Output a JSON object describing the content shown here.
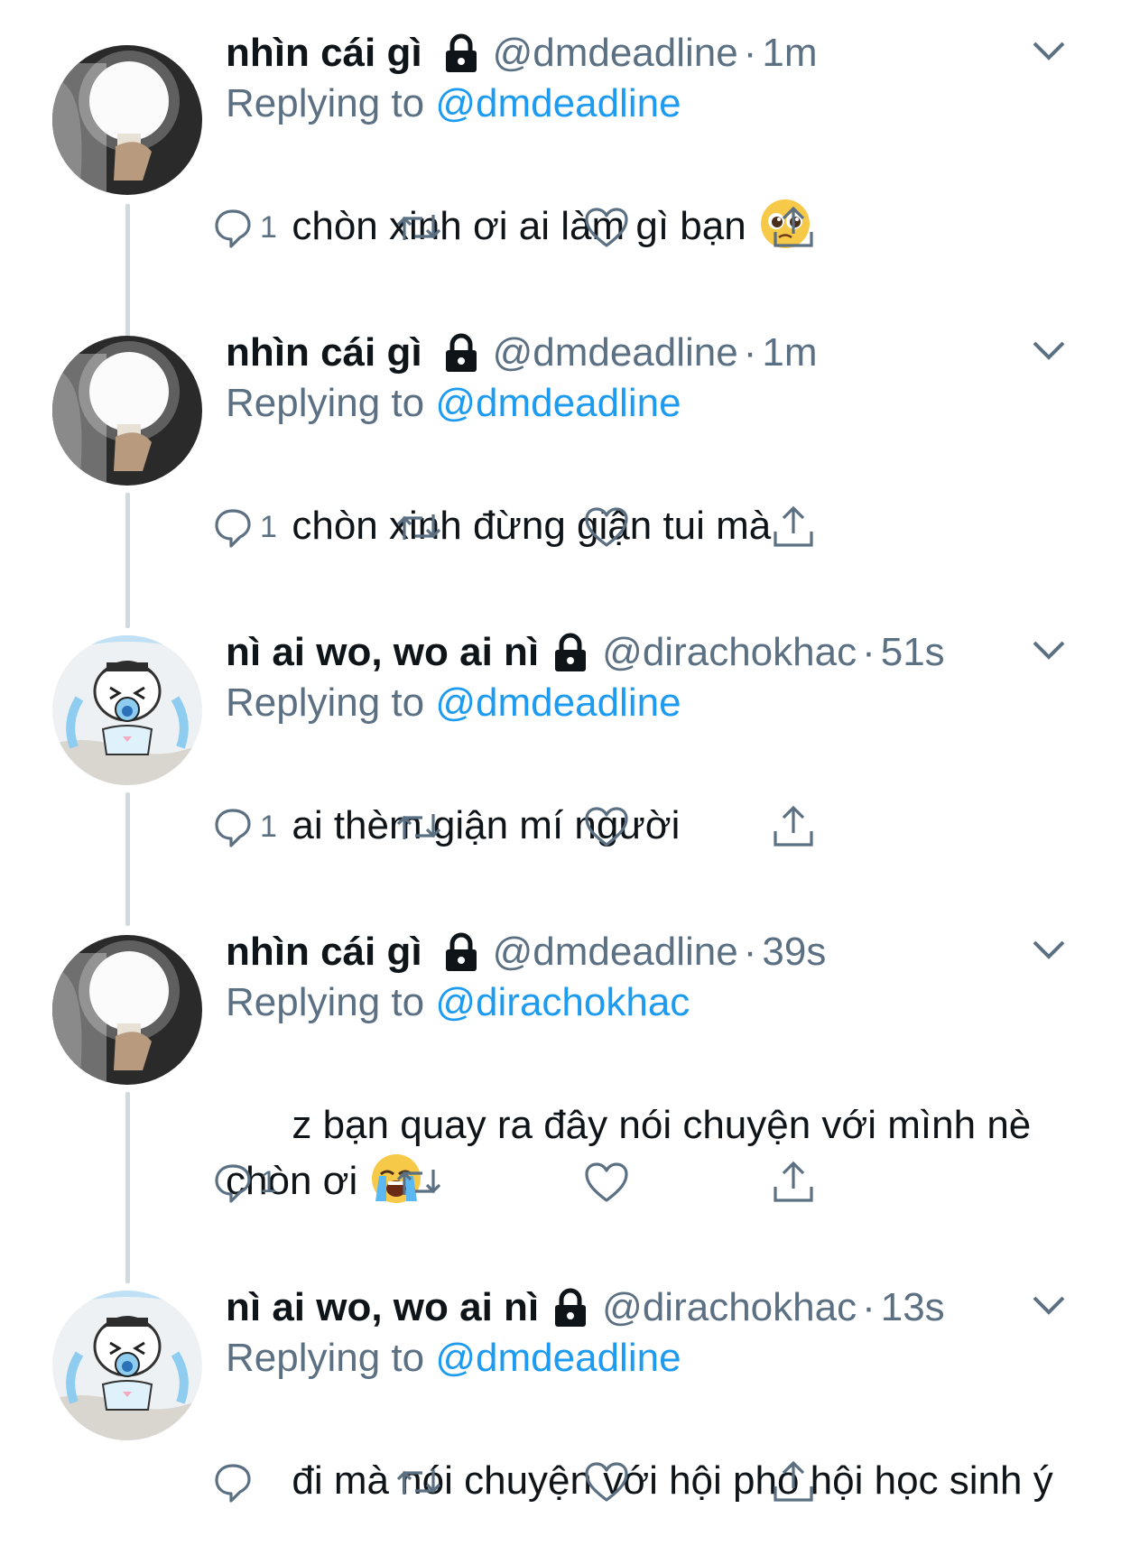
{
  "replying_prefix": "Replying to",
  "tweets": [
    {
      "display_name": "nhìn cái gì",
      "handle": "@dmdeadline",
      "separator": "·",
      "time": "1m",
      "replying_to": "@dmdeadline",
      "text": "chòn xinh ơi ai làm gì bạn",
      "emoji": "pleading-face",
      "reply_count": "1",
      "avatar": "lightbulb-photo"
    },
    {
      "display_name": "nhìn cái gì",
      "handle": "@dmdeadline",
      "separator": "·",
      "time": "1m",
      "replying_to": "@dmdeadline",
      "text": "chòn xinh đừng giận tui mà",
      "emoji": "",
      "reply_count": "1",
      "avatar": "lightbulb-photo"
    },
    {
      "display_name": "nì ai wo, wo ai nì",
      "handle": "@dirachokhac",
      "separator": "·",
      "time": "51s",
      "replying_to": "@dmdeadline",
      "text": "ai thèm giận mí người",
      "emoji": "",
      "reply_count": "1",
      "avatar": "crying-cartoon"
    },
    {
      "display_name": "nhìn cái gì",
      "handle": "@dmdeadline",
      "separator": "·",
      "time": "39s",
      "replying_to": "@dirachokhac",
      "text": "z bạn quay ra đây nói chuyện với mình nè\nchòn ơi",
      "emoji": "loudly-crying-face",
      "reply_count": "1",
      "avatar": "lightbulb-photo"
    },
    {
      "display_name": "nì ai wo, wo ai nì",
      "handle": "@dirachokhac",
      "separator": "·",
      "time": "13s",
      "replying_to": "@dmdeadline",
      "text": "đi mà nói chuyện với hội phó hội học sinh ý",
      "emoji": "",
      "reply_count": "",
      "avatar": "crying-cartoon"
    }
  ],
  "icons": {
    "lock": "lock-icon",
    "caret": "chevron-down-icon",
    "reply": "reply-icon",
    "retweet": "retweet-icon",
    "like": "heart-icon",
    "share": "share-icon"
  },
  "colors": {
    "text": "#0f1419",
    "secondary": "#5b7083",
    "link": "#1d9bf0",
    "thread_line": "#cfd9de"
  }
}
